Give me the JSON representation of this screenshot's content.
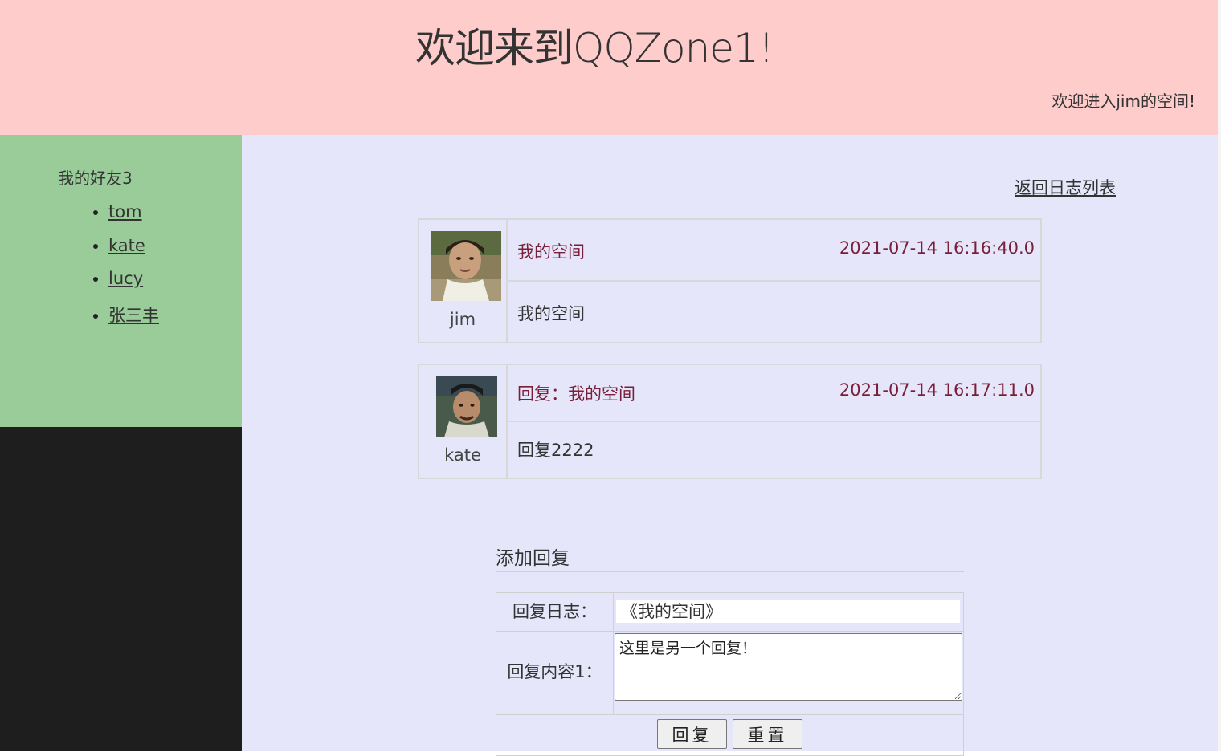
{
  "header": {
    "title": "欢迎来到QQZone1!",
    "welcome": "欢迎进入jim的空间!"
  },
  "sidebar": {
    "friends_title": "我的好友3",
    "friends": [
      "tom",
      "kate",
      "lucy",
      "张三丰"
    ]
  },
  "main": {
    "back_link": "返回日志列表",
    "posts": [
      {
        "author": "jim",
        "title": "我的空间",
        "time": "2021-07-14 16:16:40.0",
        "body": "我的空间"
      },
      {
        "author": "kate",
        "title": "回复：我的空间",
        "time": "2021-07-14 16:17:11.0",
        "body": "回复2222"
      }
    ],
    "reply": {
      "heading": "添加回复",
      "journal_label": "回复日志：",
      "journal_value": "《我的空间》",
      "content_label": "回复内容1：",
      "content_value": "这里是另一个回复！",
      "submit_label": "回复",
      "reset_label": "重置"
    }
  },
  "colors": {
    "header_bg": "#ffcccc",
    "sidebar_bg": "#99cc99",
    "main_bg": "#e6e6fa",
    "post_text": "#7a1f3a"
  }
}
